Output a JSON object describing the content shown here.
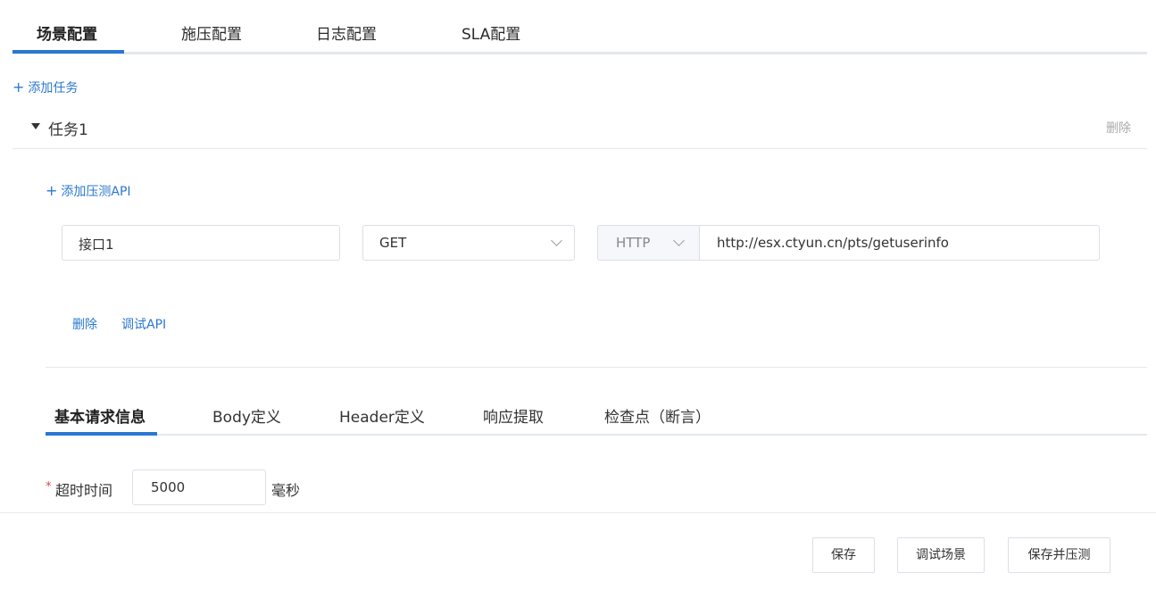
{
  "top_tabs": [
    "场景配置",
    "施压配置",
    "日志配置",
    "SLA配置"
  ],
  "add_task_label": "添加任务",
  "task": {
    "title": "任务1",
    "delete_label": "删除",
    "add_api_label": "添加压测API",
    "api": {
      "name": "接口1",
      "method": "GET",
      "protocol": "HTTP",
      "url": "http://esx.ctyun.cn/pts/getuserinfo",
      "delete_label": "删除",
      "debug_label": "调试API"
    }
  },
  "sub_tabs": [
    "基本请求信息",
    "Body定义",
    "Header定义",
    "响应提取",
    "检查点（断言）"
  ],
  "timeout": {
    "required_mark": "*",
    "label": "超时时间",
    "value": "5000",
    "unit": "毫秒"
  },
  "footer": {
    "save": "保存",
    "debug_scene": "调试场景",
    "save_and_test": "保存并压测"
  },
  "colors": {
    "accent": "#2a78d1",
    "required": "#e0463a"
  }
}
